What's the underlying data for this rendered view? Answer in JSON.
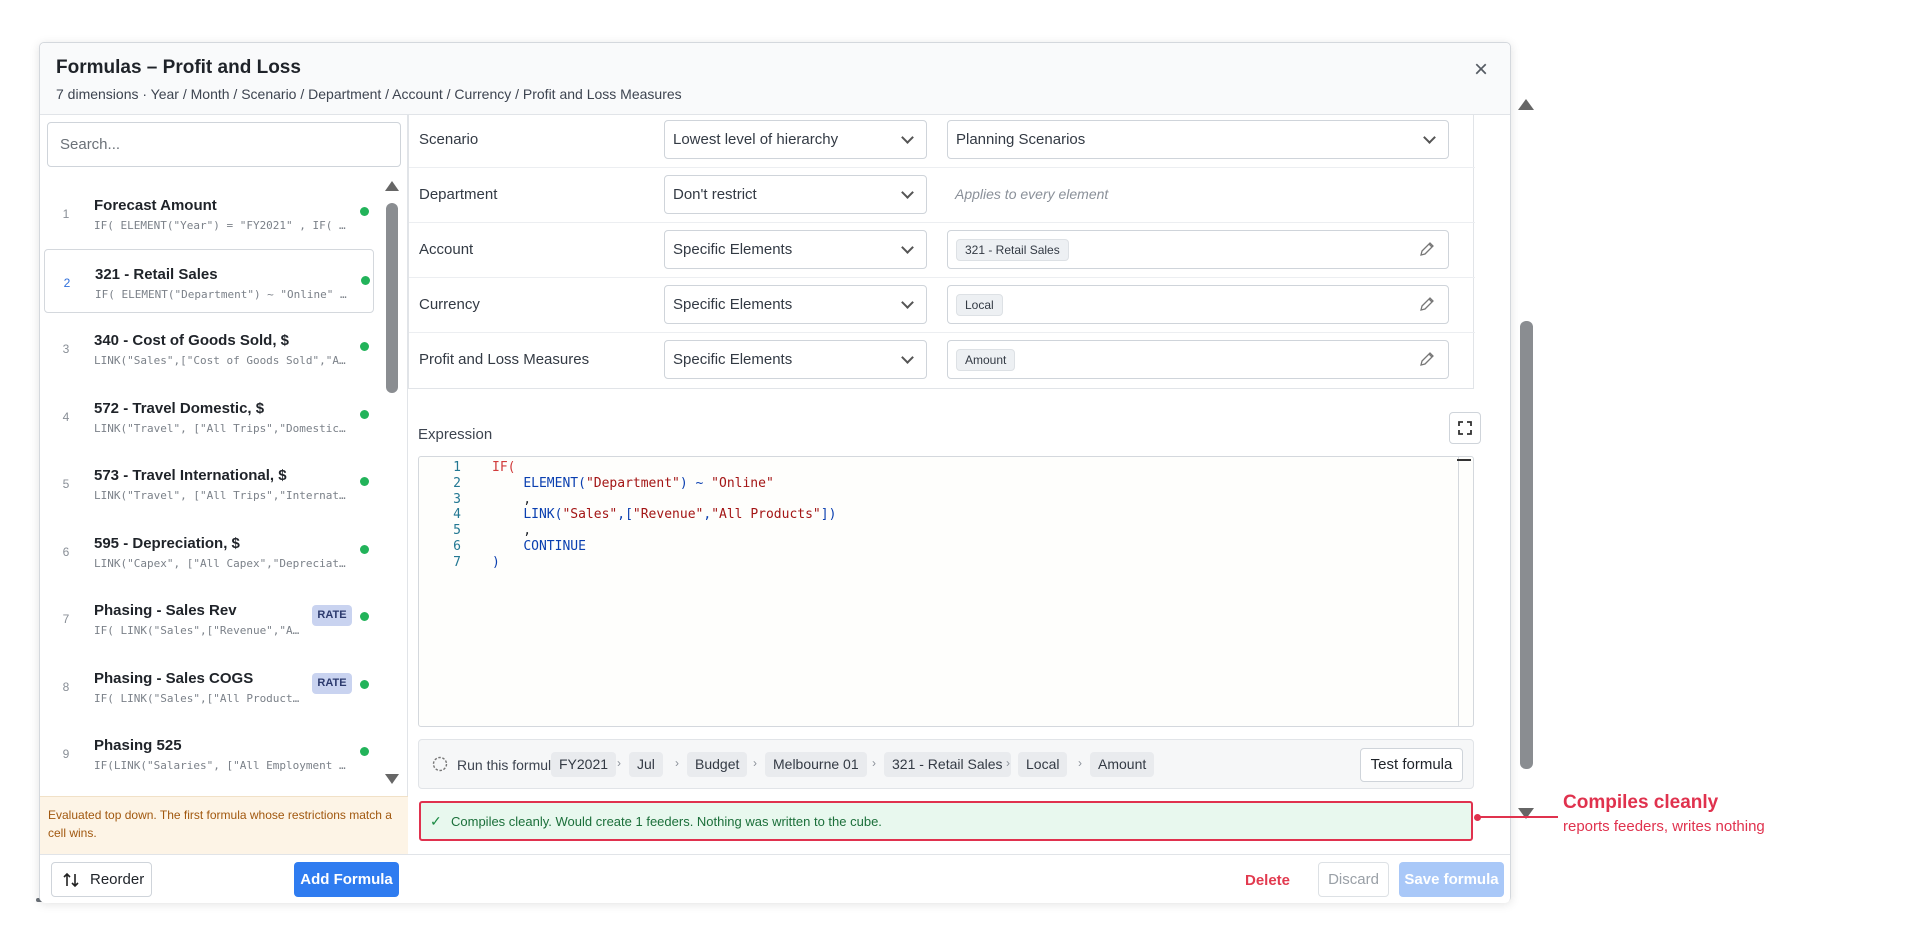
{
  "modal": {
    "title": "Formulas – Profit and Loss",
    "subtitle": "7 dimensions · Year / Month / Scenario / Department / Account / Currency / Profit and Loss Measures",
    "close_glyph": "×"
  },
  "search": {
    "placeholder": "Search..."
  },
  "formulas": [
    {
      "num": "1",
      "name": "Forecast Amount",
      "code": "IF( ELEMENT(\"Year\") = \"FY2021\" , IF( …",
      "badge": "",
      "status": "ok"
    },
    {
      "num": "2",
      "name": "321 - Retail Sales",
      "code": "IF( ELEMENT(\"Department\") ~ \"Online\" …",
      "badge": "",
      "status": "ok",
      "selected": true
    },
    {
      "num": "3",
      "name": "340 - Cost of Goods Sold, $",
      "code": "LINK(\"Sales\",[\"Cost of Goods Sold\",\"A…",
      "badge": "",
      "status": "ok"
    },
    {
      "num": "4",
      "name": "572 - Travel Domestic, $",
      "code": "LINK(\"Travel\", [\"All Trips\",\"Domestic…",
      "badge": "",
      "status": "ok"
    },
    {
      "num": "5",
      "name": "573 - Travel International, $",
      "code": "LINK(\"Travel\", [\"All Trips\",\"Internat…",
      "badge": "",
      "status": "ok"
    },
    {
      "num": "6",
      "name": "595 - Depreciation, $",
      "code": "LINK(\"Capex\", [\"All Capex\",\"Depreciat…",
      "badge": "",
      "status": "ok"
    },
    {
      "num": "7",
      "name": "Phasing - Sales Rev",
      "code": "IF( LINK(\"Sales\",[\"Revenue\",\"A…",
      "badge": "RATE",
      "status": "ok"
    },
    {
      "num": "8",
      "name": "Phasing - Sales COGS",
      "code": "IF( LINK(\"Sales\",[\"All Product…",
      "badge": "RATE",
      "status": "ok"
    },
    {
      "num": "9",
      "name": "Phasing 525",
      "code": "IF(LINK(\"Salaries\", [\"All Employment …",
      "badge": "",
      "status": "ok"
    }
  ],
  "eval_note": "Evaluated top down. The first formula whose restrictions match a cell wins.",
  "restrictions": [
    {
      "dimension": "Scenario",
      "mode": "Lowest level of hierarchy",
      "value_type": "select",
      "value": "Planning Scenarios"
    },
    {
      "dimension": "Department",
      "mode": "Don't restrict",
      "value_type": "plain",
      "value": "Applies to every element"
    },
    {
      "dimension": "Account",
      "mode": "Specific Elements",
      "value_type": "chip",
      "value": "321 - Retail Sales"
    },
    {
      "dimension": "Currency",
      "mode": "Specific Elements",
      "value_type": "chip",
      "value": "Local"
    },
    {
      "dimension": "Profit and Loss Measures",
      "mode": "Specific Elements",
      "value_type": "chip",
      "value": "Amount"
    }
  ],
  "expression": {
    "label": "Expression",
    "lines": [
      {
        "num": "1",
        "tokens": [
          {
            "t": "IF(",
            "k": "kw"
          }
        ]
      },
      {
        "num": "2",
        "tokens": [
          {
            "t": "    ",
            "k": "plain"
          },
          {
            "t": "ELEMENT(",
            "k": "fn"
          },
          {
            "t": "\"Department\"",
            "k": "str"
          },
          {
            "t": ") ~ ",
            "k": "fn"
          },
          {
            "t": "\"Online\"",
            "k": "str"
          }
        ]
      },
      {
        "num": "3",
        "tokens": [
          {
            "t": "    ,",
            "k": "plain"
          }
        ]
      },
      {
        "num": "4",
        "tokens": [
          {
            "t": "    ",
            "k": "plain"
          },
          {
            "t": "LINK(",
            "k": "fn"
          },
          {
            "t": "\"Sales\"",
            "k": "str"
          },
          {
            "t": ",[",
            "k": "fn"
          },
          {
            "t": "\"Revenue\"",
            "k": "str"
          },
          {
            "t": ",",
            "k": "fn"
          },
          {
            "t": "\"All Products\"",
            "k": "str"
          },
          {
            "t": "])",
            "k": "fn"
          }
        ]
      },
      {
        "num": "5",
        "tokens": [
          {
            "t": "    ,",
            "k": "plain"
          }
        ]
      },
      {
        "num": "6",
        "tokens": [
          {
            "t": "    ",
            "k": "plain"
          },
          {
            "t": "CONTINUE",
            "k": "fn"
          }
        ]
      },
      {
        "num": "7",
        "tokens": [
          {
            "t": ")",
            "k": "fn"
          }
        ]
      }
    ]
  },
  "run_bar": {
    "label": "Run this formula at",
    "crumbs": [
      "FY2021",
      "Jul",
      "Budget",
      "Melbourne 01",
      "321 - Retail Sales",
      "Local",
      "Amount"
    ],
    "separator": "›",
    "test_button": "Test formula"
  },
  "compile": {
    "check_glyph": "✓",
    "message": "Compiles cleanly. Would create 1 feeders. Nothing was written to the cube."
  },
  "footer": {
    "reorder": "Reorder",
    "add": "Add Formula",
    "delete": "Delete",
    "discard": "Discard",
    "save": "Save formula"
  },
  "callout": {
    "title": "Compiles cleanly",
    "subtitle": "reports feeders, writes nothing"
  },
  "colors": {
    "accent": "#2f7cf0",
    "status_ok": "#22b35a",
    "callout": "#e0324e",
    "danger": "#e23a4f"
  }
}
